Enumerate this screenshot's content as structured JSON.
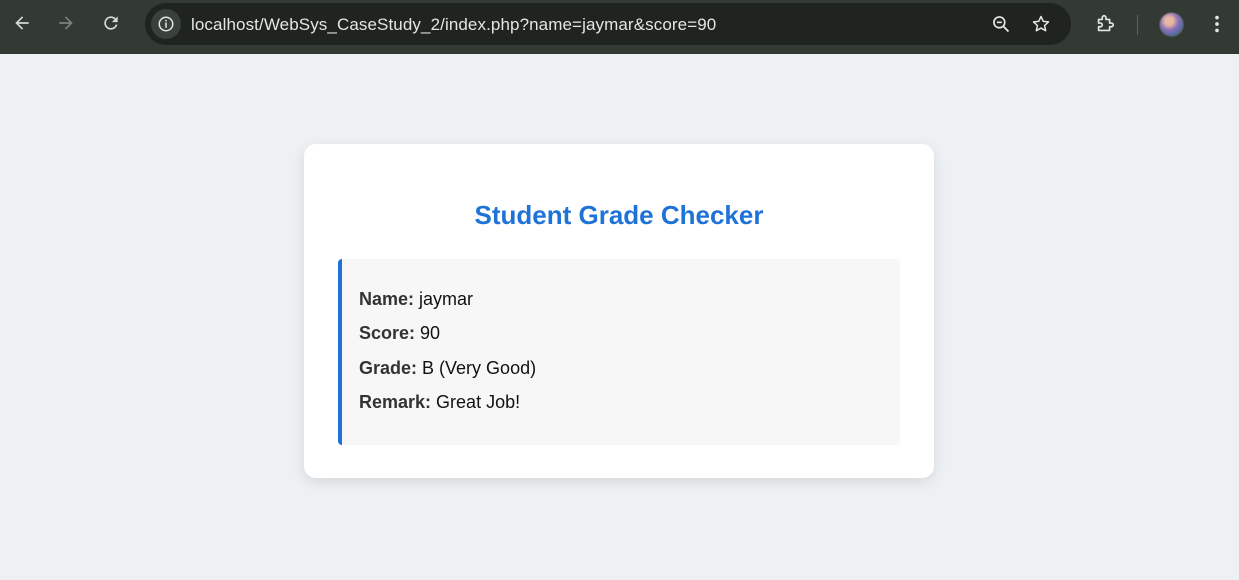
{
  "browser": {
    "url": "localhost/WebSys_CaseStudy_2/index.php?name=jaymar&score=90"
  },
  "page": {
    "title": "Student Grade Checker",
    "fields": [
      {
        "label": "Name:",
        "value": "jaymar"
      },
      {
        "label": "Score:",
        "value": "90"
      },
      {
        "label": "Grade:",
        "value": "B (Very Good)"
      },
      {
        "label": "Remark:",
        "value": "Great Job!"
      }
    ]
  },
  "colors": {
    "accent": "#1f73d8",
    "page_background": "#eef1f4",
    "toolbar_background": "#333a33"
  }
}
